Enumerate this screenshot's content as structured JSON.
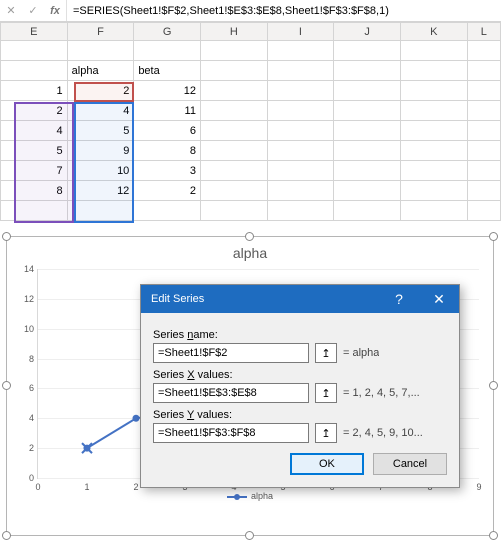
{
  "formula_bar": {
    "formula": "=SERIES(Sheet1!$F$2,Sheet1!$E$3:$E$8,Sheet1!$F$3:$F$8,1)",
    "fx_label": "fx",
    "accept_icon": "✓",
    "cancel_icon": "✕"
  },
  "columns": [
    "E",
    "F",
    "G",
    "H",
    "I",
    "J",
    "K",
    "L"
  ],
  "headers": {
    "alpha": "alpha",
    "beta": "beta"
  },
  "rows": [
    {
      "e": "1",
      "f": "2",
      "g": "12"
    },
    {
      "e": "2",
      "f": "4",
      "g": "11"
    },
    {
      "e": "4",
      "f": "5",
      "g": "6"
    },
    {
      "e": "5",
      "f": "9",
      "g": "8"
    },
    {
      "e": "7",
      "f": "10",
      "g": "3"
    },
    {
      "e": "8",
      "f": "12",
      "g": "2"
    }
  ],
  "chart": {
    "title": "alpha",
    "legend": "alpha"
  },
  "chart_data": {
    "type": "line",
    "title": "alpha",
    "xlabel": "",
    "ylabel": "",
    "xlim": [
      0,
      9
    ],
    "ylim": [
      0,
      14
    ],
    "yticks": [
      0,
      2,
      4,
      6,
      8,
      10,
      12,
      14
    ],
    "xticks": [
      0,
      1,
      2,
      3,
      4,
      5,
      6,
      7,
      8,
      9
    ],
    "series": [
      {
        "name": "alpha",
        "x": [
          1,
          2,
          4,
          5,
          7,
          8
        ],
        "y": [
          2,
          4,
          5,
          9,
          10,
          12
        ],
        "color": "#4472c4"
      }
    ]
  },
  "dialog": {
    "title": "Edit Series",
    "help_icon": "?",
    "close_icon": "✕",
    "name_label_pre": "Series ",
    "name_label_u": "n",
    "name_label_post": "ame:",
    "name_value": "=Sheet1!$F$2",
    "name_eq": "= alpha",
    "x_label_pre": "Series ",
    "x_label_u": "X",
    "x_label_post": " values:",
    "x_value": "=Sheet1!$E$3:$E$8",
    "x_eq": "= 1, 2, 4, 5, 7,...",
    "y_label_pre": "Series ",
    "y_label_u": "Y",
    "y_label_post": " values:",
    "y_value": "=Sheet1!$F$3:$F$8",
    "y_eq": "= 2, 4, 5, 9, 10...",
    "picker_icon": "↥",
    "ok": "OK",
    "cancel": "Cancel"
  }
}
